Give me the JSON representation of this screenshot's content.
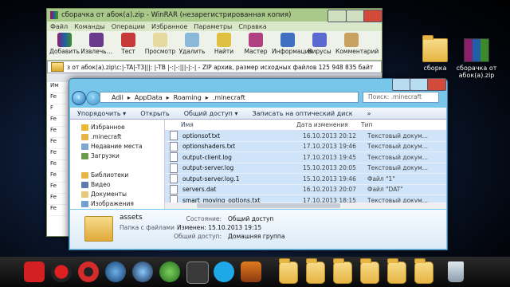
{
  "desktop": {
    "icons": [
      {
        "label": "сборка",
        "type": "folder"
      },
      {
        "label": "сборачка от\nабок(а).zip",
        "type": "rar"
      }
    ]
  },
  "winrar": {
    "title": "сборачка от абок(а).zip - WinRAR (незарегистрированная копия)",
    "menu": [
      "Файл",
      "Команды",
      "Операции",
      "Избранное",
      "Параметры",
      "Справка"
    ],
    "toolbar": [
      "Добавить",
      "Извлечь...",
      "Тест",
      "Просмотр",
      "Удалить",
      "Найти",
      "Мастер",
      "Информация",
      "Вирусы",
      "Комментарий"
    ],
    "path": "з от абок(а).zip\\с:|-TA|-T3|||: |-TB |-:|-:|||-|:-| - ZIP архив, размер исходных файлов 125 948 835 байт",
    "left_items": [
      "Им",
      "Fe",
      "F",
      "Fe",
      "Fe",
      "Fe",
      "Fe",
      "Fe",
      "Fe",
      "Fe",
      "Fe",
      "Fe"
    ]
  },
  "explorer": {
    "breadcrumb": [
      "Adil",
      "AppData",
      "Roaming",
      ".minecraft"
    ],
    "search_placeholder": "Поиск: .minecraft",
    "commands": [
      "Упорядочить ▾",
      "Открыть",
      "Общий доступ ▾",
      "Записать на оптический диск",
      "»"
    ],
    "nav_pane": [
      {
        "label": "Избранное",
        "icon": "star-icon",
        "color": "#e8b830"
      },
      {
        "label": ".minecraft",
        "icon": "folder-icon",
        "color": "#e6b543"
      },
      {
        "label": "Недавние места",
        "icon": "recent-icon",
        "color": "#7aa6d0"
      },
      {
        "label": "Загрузки",
        "icon": "download-icon",
        "color": "#6a9a4a"
      },
      {
        "label": "",
        "icon": "",
        "color": "transparent"
      },
      {
        "label": "Библиотеки",
        "icon": "library-icon",
        "color": "#e6b543"
      },
      {
        "label": "Видео",
        "icon": "video-icon",
        "color": "#5a7ab0"
      },
      {
        "label": "Документы",
        "icon": "document-icon",
        "color": "#e6c87a"
      },
      {
        "label": "Изображения",
        "icon": "image-icon",
        "color": "#70a0d0"
      }
    ],
    "columns": {
      "name": "Имя",
      "date": "Дата изменения",
      "type": "Тип"
    },
    "files": [
      {
        "name": "optionsof.txt",
        "date": "16.10.2013 20:12",
        "type": "Текстовый докум..."
      },
      {
        "name": "optionshaders.txt",
        "date": "17.10.2013 19:46",
        "type": "Текстовый докум..."
      },
      {
        "name": "output-client.log",
        "date": "17.10.2013 19:45",
        "type": "Текстовый докум..."
      },
      {
        "name": "output-server.log",
        "date": "15.10.2013 20:05",
        "type": "Текстовый докум..."
      },
      {
        "name": "output-server.log.1",
        "date": "15.10.2013 19:46",
        "type": "Файл \"1\""
      },
      {
        "name": "servers.dat",
        "date": "16.10.2013 20:07",
        "type": "Файл \"DAT\""
      },
      {
        "name": "smart_moving_options.txt",
        "date": "17.10.2013 18:15",
        "type": "Текстовый докум..."
      }
    ],
    "details": {
      "name": "assets",
      "state_label": "Состояние:",
      "state_value": "Общий доступ",
      "folder_label": "Папка с файлами",
      "folder_value": "Изменен: 15.10.2013 19:15",
      "share_label": "Общий доступ:",
      "share_value": "Домашняя группа"
    }
  },
  "dock": {
    "icons": [
      "yandex-browser-icon",
      "record-icon",
      "opera-icon",
      "app-icon",
      "security-icon",
      "utorrent-icon",
      "steam-icon",
      "skype-icon",
      "game-icon",
      "folder-icon",
      "folder-icon",
      "folder-icon",
      "folder-icon",
      "folder-icon",
      "folder-icon",
      "recycle-bin-icon"
    ]
  }
}
